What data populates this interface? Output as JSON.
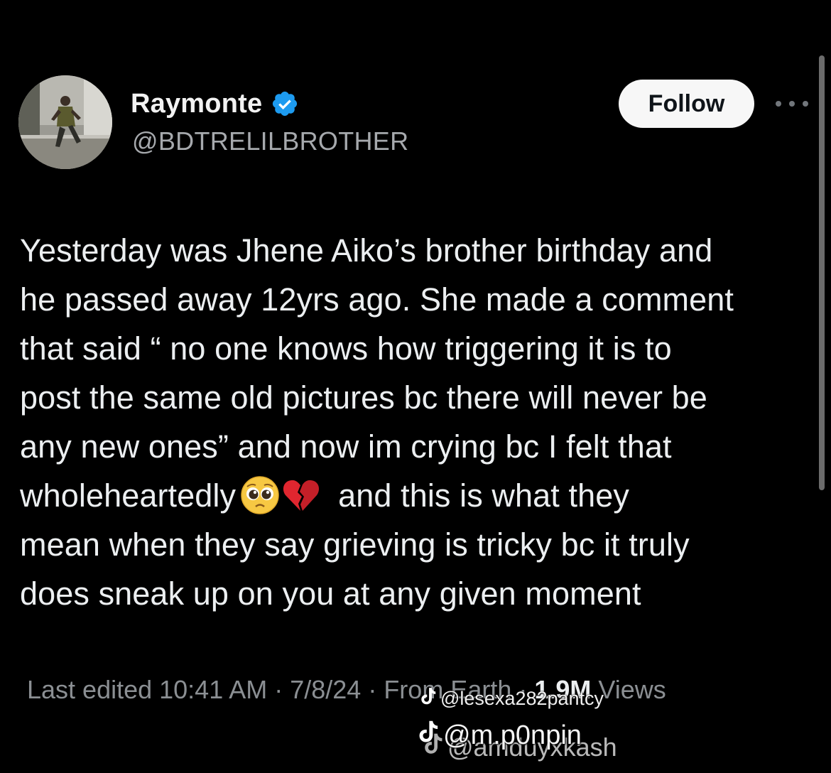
{
  "author": {
    "display_name": "Raymonte",
    "handle": "@BDTRELILBROTHER",
    "verified": true,
    "verified_color": "#1d9bf0"
  },
  "actions": {
    "follow_label": "Follow",
    "more_icon": "more-horizontal-icon"
  },
  "tweet": {
    "lines": [
      "Yesterday was Jhene Aiko’s brother birthday and",
      "he passed away 12yrs ago. She made a comment",
      "that said “ no one knows how triggering it is to",
      "post the same old pictures bc there will never be",
      "any new ones” and now im crying bc I felt that",
      "wholeheartedly",
      "and this is what they",
      "mean when they say grieving is tricky bc it truly",
      "does sneak up on you at any given moment"
    ],
    "emojis": [
      "pleading-face-emoji",
      "broken-heart-emoji"
    ]
  },
  "meta": {
    "edited_prefix": "Last edited 10:41 AM · 7/8/24 · From Earth · ",
    "views_count": "1.9M",
    "views_label": " Views"
  },
  "watermarks": {
    "first": "@lesexa282pantcy",
    "second": "@m.p0npin",
    "third": "@amduyxkash"
  },
  "colors": {
    "background": "#000000",
    "text": "#e7e9ea",
    "muted": "#8b8f93",
    "follow_bg": "#f7f7f7"
  }
}
